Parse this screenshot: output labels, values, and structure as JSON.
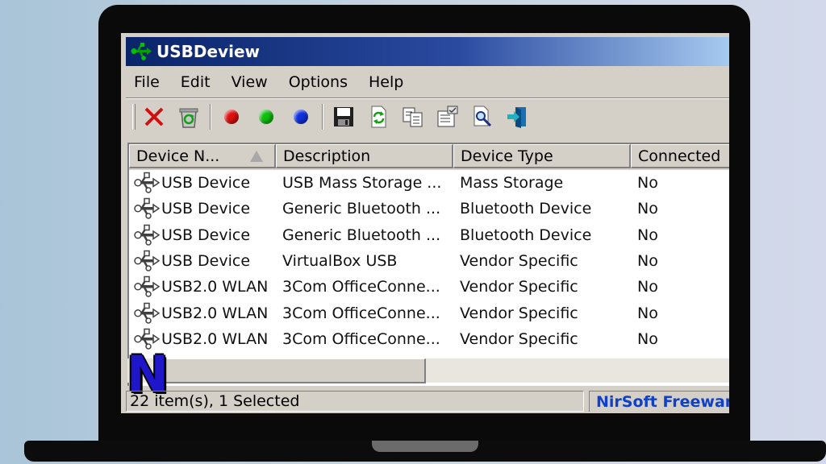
{
  "window": {
    "title": "USBDeview"
  },
  "menu": [
    "File",
    "Edit",
    "View",
    "Options",
    "Help"
  ],
  "toolbar": {
    "icons": [
      "disconnect-icon",
      "uninstall-icon",
      "red-dot-icon",
      "green-dot-icon",
      "blue-dot-icon",
      "save-icon",
      "refresh-icon",
      "copy-icon",
      "properties-icon",
      "find-icon",
      "exit-icon"
    ]
  },
  "columns": [
    "Device N...",
    "Description",
    "Device Type",
    "Connected"
  ],
  "rows": [
    [
      "USB Device",
      "USB Mass Storage ...",
      "Mass Storage",
      "No"
    ],
    [
      "USB Device",
      "Generic Bluetooth ...",
      "Bluetooth Device",
      "No"
    ],
    [
      "USB Device",
      "Generic Bluetooth ...",
      "Bluetooth Device",
      "No"
    ],
    [
      "USB Device",
      "VirtualBox USB",
      "Vendor Specific",
      "No"
    ],
    [
      "USB2.0 WLAN",
      "3Com OfficeConne...",
      "Vendor Specific",
      "No"
    ],
    [
      "USB2.0 WLAN",
      "3Com OfficeConne...",
      "Vendor Specific",
      "No"
    ],
    [
      "USB2.0 WLAN",
      "3Com OfficeConne...",
      "Vendor Specific",
      "No"
    ]
  ],
  "logo": {
    "letter": "N"
  },
  "status": {
    "items": "22 item(s), 1 Selected",
    "brand": "NirSoft Freewar"
  },
  "colors": {
    "titlebar_start": "#0a246a",
    "titlebar_end": "#a6caf0",
    "brand_text": "#1040c8",
    "logo": "#1e16c8"
  }
}
